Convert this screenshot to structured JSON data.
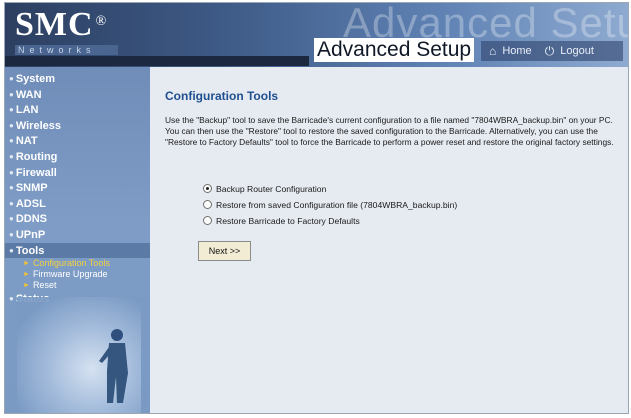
{
  "header": {
    "logo": "SMC",
    "logo_mark": "®",
    "logo_sub": "Networks",
    "watermark": "Advanced Setup",
    "title": "Advanced Setup",
    "home_label": "Home",
    "logout_label": "Logout",
    "home_icon": "home-icon",
    "logout_icon": "power-icon"
  },
  "sidebar": {
    "items": [
      {
        "label": "System"
      },
      {
        "label": "WAN"
      },
      {
        "label": "LAN"
      },
      {
        "label": "Wireless"
      },
      {
        "label": "NAT"
      },
      {
        "label": "Routing"
      },
      {
        "label": "Firewall"
      },
      {
        "label": "SNMP"
      },
      {
        "label": "ADSL"
      },
      {
        "label": "DDNS"
      },
      {
        "label": "UPnP"
      },
      {
        "label": "Tools"
      }
    ],
    "tools_sub": [
      {
        "label": "Configuration Tools"
      },
      {
        "label": "Firmware Upgrade"
      },
      {
        "label": "Reset"
      }
    ],
    "after": {
      "label": "Status"
    }
  },
  "content": {
    "title": "Configuration Tools",
    "description": "Use the \"Backup\" tool to save the Barricade's current configuration to a file named \"7804WBRA_backup.bin\" on your PC. You can then use the \"Restore\" tool to restore the saved configuration to the Barricade. Alternatively, you can use the \"Restore to Factory Defaults\" tool to force the Barricade to perform a power reset and restore the original factory settings.",
    "options": [
      {
        "label": "Backup Router Configuration",
        "checked": true
      },
      {
        "label": "Restore from saved Configuration file (7804WBRA_backup.bin)",
        "checked": false
      },
      {
        "label": "Restore Barricade to Factory Defaults",
        "checked": false
      }
    ],
    "next_label": "Next >>"
  },
  "colors": {
    "accent_title": "#1f4f8f",
    "sidebar_bg": "#7a9ac4",
    "content_bg": "#e6ebf2",
    "current_link": "#f4d03f"
  }
}
